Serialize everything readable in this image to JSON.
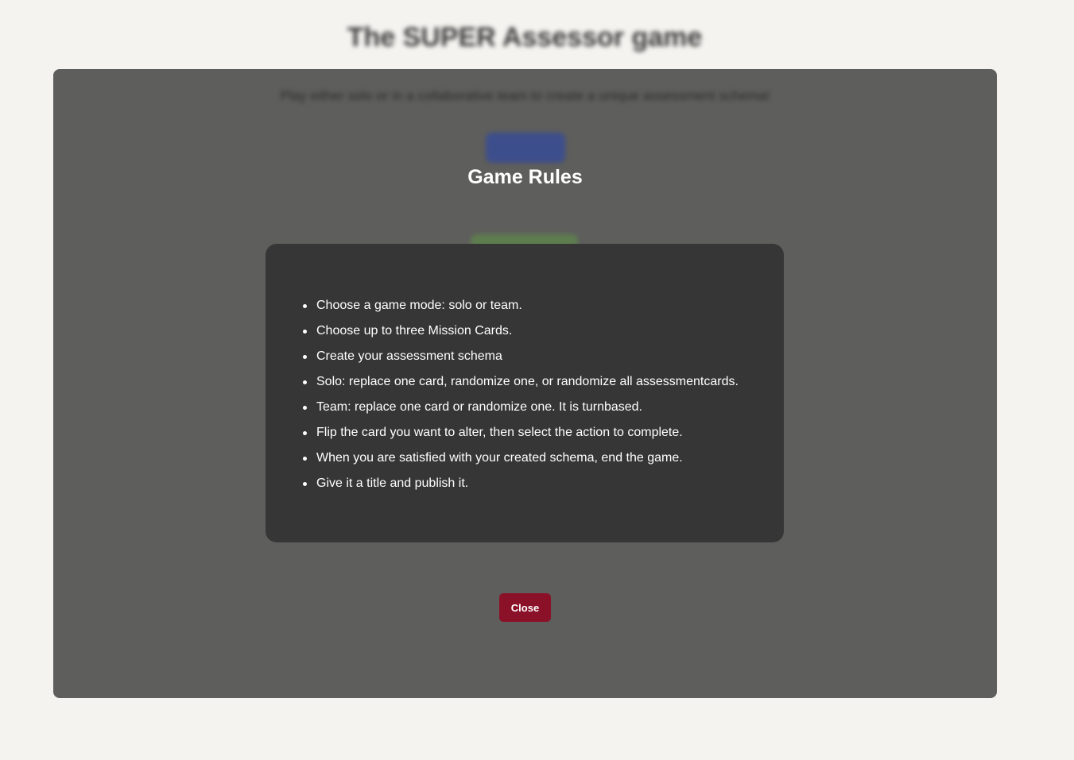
{
  "page": {
    "title": "The SUPER Assessor game"
  },
  "background": {
    "subtitle": "Play either solo or in a collaborative team to create a unique assessment schema!"
  },
  "modal": {
    "heading": "Game Rules",
    "rules": [
      "Choose a game mode: solo or team.",
      "Choose up to three Mission Cards.",
      "Create your assessment schema",
      "Solo: replace one card, randomize one, or randomize all assessmentcards.",
      "Team: replace one card or randomize one. It is turnbased.",
      "Flip the card you want to alter, then select the action to complete.",
      "When you are satisfied with your created schema, end the game.",
      "Give it a title and publish it."
    ],
    "close_label": "Close"
  },
  "colors": {
    "page_background": "#f4f3ef",
    "overlay": "#5e5e5c",
    "card": "#363636",
    "close_button": "#8b1129"
  }
}
